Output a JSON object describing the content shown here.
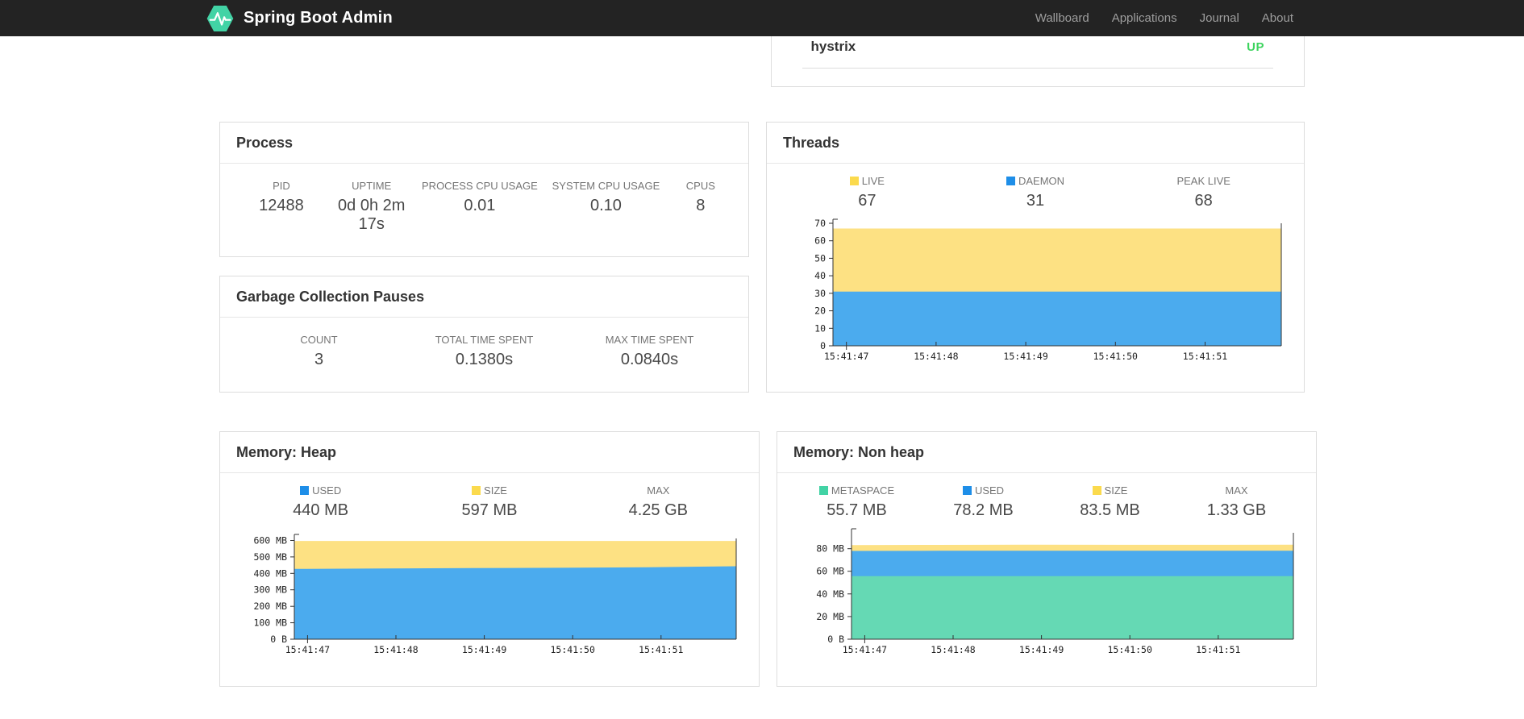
{
  "navbar": {
    "brand": "Spring Boot Admin",
    "links": [
      {
        "label": "Wallboard"
      },
      {
        "label": "Applications"
      },
      {
        "label": "Journal"
      },
      {
        "label": "About"
      }
    ],
    "colors": {
      "background": "#232323",
      "brand_text": "#ffffff",
      "link_text": "#9d9d9d",
      "logo_green": "#42d3a5"
    }
  },
  "health_card": {
    "rows": [
      {
        "name": "hystrix",
        "status": "UP"
      }
    ],
    "status_up_color": "#3ed45f"
  },
  "process_card": {
    "title": "Process",
    "stats": [
      {
        "label": "PID",
        "value": "12488"
      },
      {
        "label": "UPTIME",
        "value": "0d 0h 2m 17s"
      },
      {
        "label": "PROCESS CPU USAGE",
        "value": "0.01"
      },
      {
        "label": "SYSTEM CPU USAGE",
        "value": "0.10"
      },
      {
        "label": "CPUS",
        "value": "8"
      }
    ]
  },
  "gc_card": {
    "title": "Garbage Collection Pauses",
    "stats": [
      {
        "label": "COUNT",
        "value": "3"
      },
      {
        "label": "TOTAL TIME SPENT",
        "value": "0.1380s"
      },
      {
        "label": "MAX TIME SPENT",
        "value": "0.0840s"
      }
    ]
  },
  "threads_card": {
    "title": "Threads",
    "stats": [
      {
        "label": "LIVE",
        "value": "67",
        "swatch": "#fbda4d"
      },
      {
        "label": "DAEMON",
        "value": "31",
        "swatch": "#1e8ee8"
      },
      {
        "label": "PEAK LIVE",
        "value": "68"
      }
    ]
  },
  "heap_card": {
    "title": "Memory: Heap",
    "stats": [
      {
        "label": "USED",
        "value": "440 MB",
        "swatch": "#1e8ee8"
      },
      {
        "label": "SIZE",
        "value": "597 MB",
        "swatch": "#fbda4d"
      },
      {
        "label": "MAX",
        "value": "4.25 GB"
      }
    ]
  },
  "nonheap_card": {
    "title": "Memory: Non heap",
    "stats": [
      {
        "label": "METASPACE",
        "value": "55.7 MB",
        "swatch": "#42d3a5"
      },
      {
        "label": "USED",
        "value": "78.2 MB",
        "swatch": "#1e8ee8"
      },
      {
        "label": "SIZE",
        "value": "83.5 MB",
        "swatch": "#fbda4d"
      },
      {
        "label": "MAX",
        "value": "1.33 GB"
      }
    ]
  },
  "chart_data": [
    {
      "id": "threads",
      "type": "area",
      "title": "Threads",
      "render": "overlay-areas-back-to-front",
      "x_tick_labels": [
        "15:41:47",
        "15:41:48",
        "15:41:49",
        "15:41:50",
        "15:41:51"
      ],
      "ylim": [
        0,
        70
      ],
      "yticks": [
        0,
        10,
        20,
        30,
        40,
        50,
        60,
        70
      ],
      "ytick_labels": [
        "0",
        "10",
        "20",
        "30",
        "40",
        "50",
        "60",
        "70"
      ],
      "legend_position": "above-chart",
      "grid": false,
      "series_draw_order": [
        {
          "name": "LIVE",
          "fill": "#fde183",
          "values": [
            67,
            67,
            67,
            67,
            67,
            67
          ]
        },
        {
          "name": "DAEMON",
          "fill": "#4babee",
          "values": [
            31,
            31,
            31,
            31,
            31,
            31
          ]
        }
      ]
    },
    {
      "id": "heap",
      "type": "area",
      "title": "Memory: Heap",
      "render": "overlay-areas-back-to-front",
      "x_tick_labels": [
        "15:41:47",
        "15:41:48",
        "15:41:49",
        "15:41:50",
        "15:41:51"
      ],
      "ylim": [
        0,
        612
      ],
      "yticks": [
        0,
        100,
        200,
        300,
        400,
        500,
        600
      ],
      "ytick_labels": [
        "0 B",
        "100 MB",
        "200 MB",
        "300 MB",
        "400 MB",
        "500 MB",
        "600 MB"
      ],
      "legend_position": "above-chart",
      "grid": false,
      "series_draw_order": [
        {
          "name": "SIZE",
          "fill": "#fde183",
          "values": [
            597,
            597,
            597,
            597,
            597,
            597
          ]
        },
        {
          "name": "USED",
          "fill": "#4babee",
          "values": [
            427,
            430,
            432,
            434,
            437,
            443
          ]
        }
      ]
    },
    {
      "id": "nonheap",
      "type": "area",
      "title": "Memory: Non heap",
      "render": "overlay-areas-back-to-front",
      "x_tick_labels": [
        "15:41:47",
        "15:41:48",
        "15:41:49",
        "15:41:50",
        "15:41:51"
      ],
      "ylim": [
        0,
        94
      ],
      "yticks": [
        0,
        20,
        40,
        60,
        80
      ],
      "ytick_labels": [
        "0 B",
        "20 MB",
        "40 MB",
        "60 MB",
        "80 MB"
      ],
      "legend_position": "above-chart",
      "grid": false,
      "series_draw_order": [
        {
          "name": "SIZE",
          "fill": "#fde183",
          "values": [
            83.2,
            83.3,
            83.5,
            83.4,
            83.4,
            83.5
          ]
        },
        {
          "name": "USED",
          "fill": "#4babee",
          "values": [
            78.0,
            78.1,
            78.2,
            78.1,
            78.1,
            78.2
          ]
        },
        {
          "name": "METASPACE",
          "fill": "#65d9b4",
          "values": [
            55.7,
            55.7,
            55.7,
            55.7,
            55.7,
            55.7
          ]
        }
      ]
    }
  ]
}
